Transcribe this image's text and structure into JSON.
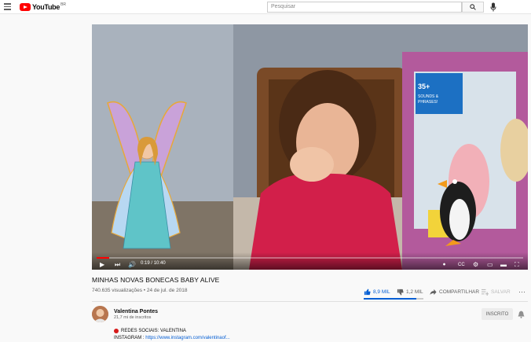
{
  "header": {
    "logo_text": "YouTube",
    "logo_region": "BR",
    "search_placeholder": "Pesquisar"
  },
  "player": {
    "time_current": "0:19",
    "time_total": "10:40",
    "progress": 0.03,
    "box_text": "35+ SOUNDS & PHRASES!"
  },
  "video": {
    "title": "MINHAS NOVAS BONECAS BABY ALIVE",
    "views_date": "740.635 visualizações • 24 de jul. de 2018",
    "likes": "8,9 MIL",
    "dislikes": "1,2 MIL",
    "share_label": "COMPARTILHAR",
    "save_label": "SALVAR",
    "like_ratio": 0.88
  },
  "channel": {
    "name": "Valentina Pontes",
    "subs": "21,7 mi de inscritos",
    "subscribe_label": "INSCRITO"
  },
  "description": {
    "line1": "REDES SOCIAIS: VALENTINA",
    "line2_prefix": "INSTAGRAM : ",
    "line2_link": "https://www.instagram.com/valentinaof..."
  },
  "colors": {
    "accent": "#ff0000",
    "link": "#065fd4"
  }
}
